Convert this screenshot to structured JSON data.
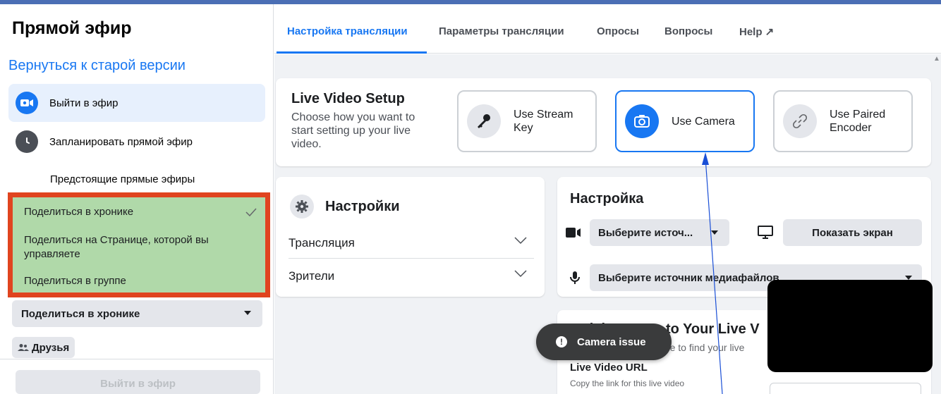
{
  "sidebar": {
    "title": "Прямой эфир",
    "back_link": "Вернуться к старой версии",
    "items": [
      {
        "label": "Выйти в эфир",
        "icon": "video-camera-icon"
      },
      {
        "label": "Запланировать прямой эфир",
        "icon": "clock-icon"
      }
    ],
    "sub_item": "Предстоящие прямые эфиры",
    "share_options": [
      "Поделиться в хронике",
      "Поделиться на Странице, которой вы управляете",
      "Поделиться в группе"
    ],
    "share_selected": "Поделиться в хронике",
    "audience": "Друзья",
    "go_live_button": "Выйти в эфир"
  },
  "tabs": [
    "Настройка трансляции",
    "Параметры трансляции",
    "Опросы",
    "Вопросы",
    "Help ↗"
  ],
  "setup": {
    "title": "Live Video Setup",
    "description": "Choose how you want to start setting up your live video.",
    "options": [
      {
        "label": "Use Stream Key",
        "icon": "key-icon"
      },
      {
        "label": "Use Camera",
        "icon": "camera-icon",
        "selected": true
      },
      {
        "label": "Use Paired Encoder",
        "icon": "link-icon"
      }
    ]
  },
  "settings": {
    "title": "Настройки",
    "rows": [
      "Трансляция",
      "Зрители"
    ]
  },
  "config": {
    "title": "Настройка",
    "video_source": "Выберите источ...",
    "share_screen": "Показать экран",
    "media_source": "Выберите источник медиафайлов"
  },
  "quick_access": {
    "title": "Quick Access to Your Live V",
    "description": "Let viewers know where to find your live",
    "url_label": "Live Video URL",
    "copy_text": "Copy the link for this live video"
  },
  "toast": "Camera issue",
  "colors": {
    "accent": "#1877f2",
    "highlight_border": "#e0441f",
    "highlight_fill": "#b0d9a9"
  }
}
